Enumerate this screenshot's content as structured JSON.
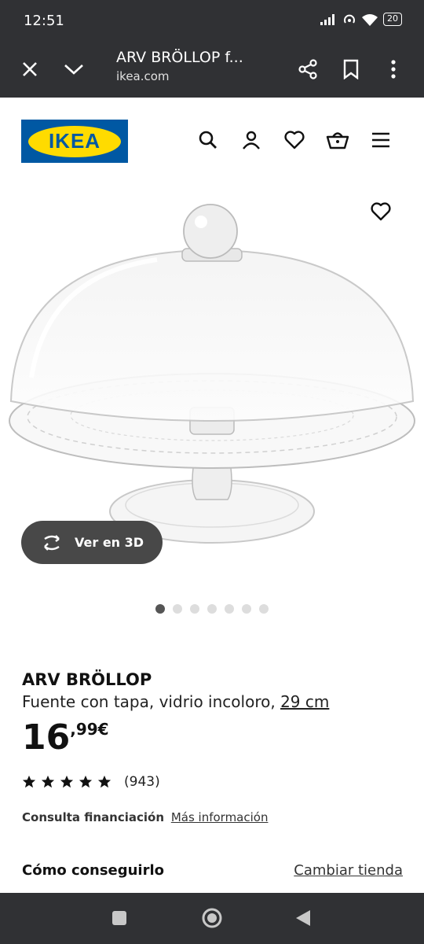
{
  "status": {
    "time": "12:51",
    "battery": "20"
  },
  "browser": {
    "title": "ARV BRÖLLOP f...",
    "domain": "ikea.com"
  },
  "brand": {
    "logo_text": "IKEA",
    "blue": "#0058a3",
    "yellow": "#ffdb00"
  },
  "header_icons": [
    "search-icon",
    "user-icon",
    "heart-icon",
    "basket-icon",
    "menu-icon"
  ],
  "gallery": {
    "view3d_label": "Ver en 3D",
    "dot_count": 7,
    "active_dot": 0
  },
  "product": {
    "name": "ARV BRÖLLOP",
    "description": "Fuente con tapa, vidrio incoloro,",
    "size": "29 cm",
    "price_int": "16",
    "price_dec": ",99€",
    "rating_stars": 5,
    "rating_count": "(943)",
    "finance_label": "Consulta financiación",
    "finance_link": "Más información"
  },
  "availability": {
    "label": "Cómo conseguirlo",
    "link": "Cambiar tienda"
  }
}
